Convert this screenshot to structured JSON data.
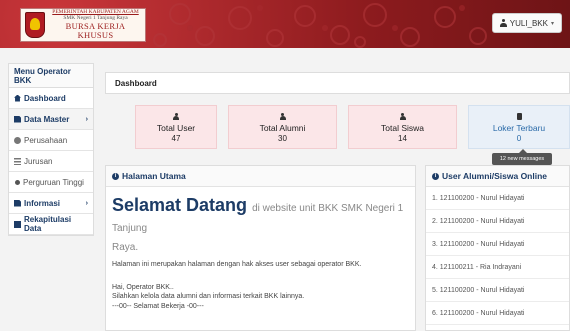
{
  "header": {
    "logo": {
      "line1": "PEMERINTAH KABUPATEN AGAM",
      "line2": "SMK Negeri 1 Tanjung Raya",
      "line3": "BURSA KERJA KHUSUS"
    },
    "user_label": "YULI_BKK",
    "colors": {
      "header_red": "#8d1b1e",
      "accent_navy": "#1d3c66"
    }
  },
  "sidebar": {
    "title": "Menu Operator BKK",
    "items": [
      {
        "label": "Dashboard",
        "icon": "home-icon"
      },
      {
        "label": "Data Master",
        "icon": "document-icon"
      },
      {
        "label": "Perusahaan",
        "icon": "globe-icon"
      },
      {
        "label": "Jurusan",
        "icon": "list-icon"
      },
      {
        "label": "Perguruan Tinggi",
        "icon": "dot-icon"
      },
      {
        "label": "Informasi",
        "icon": "document-icon"
      },
      {
        "label": "Rekapitulasi Data",
        "icon": "table-icon"
      }
    ]
  },
  "main": {
    "breadcrumb": "Dashboard",
    "stats": [
      {
        "label": "Total User",
        "value": "47"
      },
      {
        "label": "Total Alumni",
        "value": "30"
      },
      {
        "label": "Total Siswa",
        "value": "14"
      },
      {
        "label": "Loker Terbaru",
        "value": "0"
      }
    ],
    "tooltip": "12 new messages",
    "welcome": {
      "heading": "Halaman Utama",
      "title_big": "Selamat Datang",
      "title_rest": "di website unit BKK SMK Negeri 1 Tanjung",
      "title_rest2": "Raya.",
      "text": "Halaman ini merupakan halaman dengan hak akses user sebagai operator BKK.",
      "greet1": "Hai, Operator BKK..",
      "greet2": "Silahkan kelola data alumni dan informasi terkait BKK lainnya.",
      "greet3": "---00-- Selamat Bekerja -00---"
    },
    "online": {
      "heading": "User Alumni/Siswa Online",
      "rows": [
        "1. 121100200 - Nurul Hidayati",
        "2. 121100200 - Nurul Hidayati",
        "3. 121100200 - Nurul Hidayati",
        "4. 121100211 - Ria Indrayani",
        "5. 121100200 - Nurul Hidayati",
        "6. 121100200 - Nurul Hidayati"
      ]
    }
  }
}
